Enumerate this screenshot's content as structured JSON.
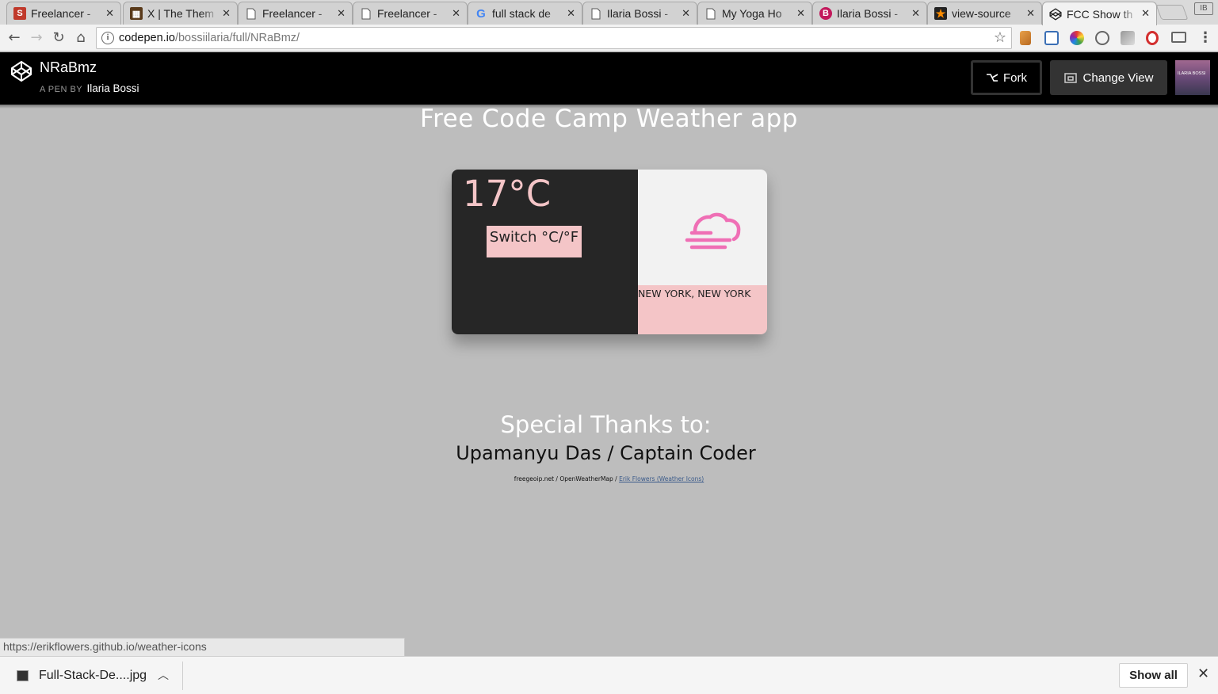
{
  "tabs": [
    {
      "title": "Freelancer - ",
      "favicon": "S",
      "fav_color": "#c0392b",
      "active": false
    },
    {
      "title": "X | The Them",
      "favicon": "▦",
      "fav_color": "#5a3a1a",
      "active": false
    },
    {
      "title": "Freelancer - ",
      "favicon": "doc",
      "fav_color": "",
      "active": false
    },
    {
      "title": "Freelancer - ",
      "favicon": "doc",
      "fav_color": "",
      "active": false
    },
    {
      "title": "full stack de",
      "favicon": "G",
      "fav_color": "",
      "active": false
    },
    {
      "title": "Ilaria Bossi - ",
      "favicon": "doc",
      "fav_color": "",
      "active": false
    },
    {
      "title": "My Yoga Ho",
      "favicon": "doc",
      "fav_color": "",
      "active": false
    },
    {
      "title": "Ilaria Bossi - ",
      "favicon": "B",
      "fav_color": "#c2185b",
      "active": false
    },
    {
      "title": "view-source",
      "favicon": "★",
      "fav_color": "#222",
      "active": false
    },
    {
      "title": "FCC Show th",
      "favicon": "codepen",
      "fav_color": "",
      "active": true
    }
  ],
  "tab_close": "✕",
  "profile_badge": "IB",
  "toolbar": {
    "url_host": "codepen.io",
    "url_path": "/bossiilaria/full/NRaBmz/",
    "star": "☆"
  },
  "codepen": {
    "pen_title": "NRaBmz",
    "pen_by": "A PEN BY",
    "author": "Ilaria Bossi",
    "fork_label": "Fork",
    "change_view_label": "Change View",
    "avatar_text": "ILARIA BOSSI"
  },
  "app": {
    "title": "Free Code Camp Weather app",
    "temperature": "17°C",
    "switch_label": "Switch °C/°F",
    "location": "NEW YORK, NEW YORK",
    "weather_icon": "fog-cloud-icon",
    "accent_color": "#f4c5c7",
    "icon_color": "#ef6fb5"
  },
  "thanks": {
    "heading": "Special Thanks to:",
    "names": "Upamanyu Das / Captain Coder",
    "credits_plain": "freegeoip.net / OpenWeatherMap / ",
    "credits_link": "Erik Flowers (Weather Icons)"
  },
  "status_url": "https://erikflowers.github.io/weather-icons",
  "downloads": {
    "file_name": "Full-Stack-De....jpg",
    "show_all": "Show all",
    "close": "✕"
  }
}
